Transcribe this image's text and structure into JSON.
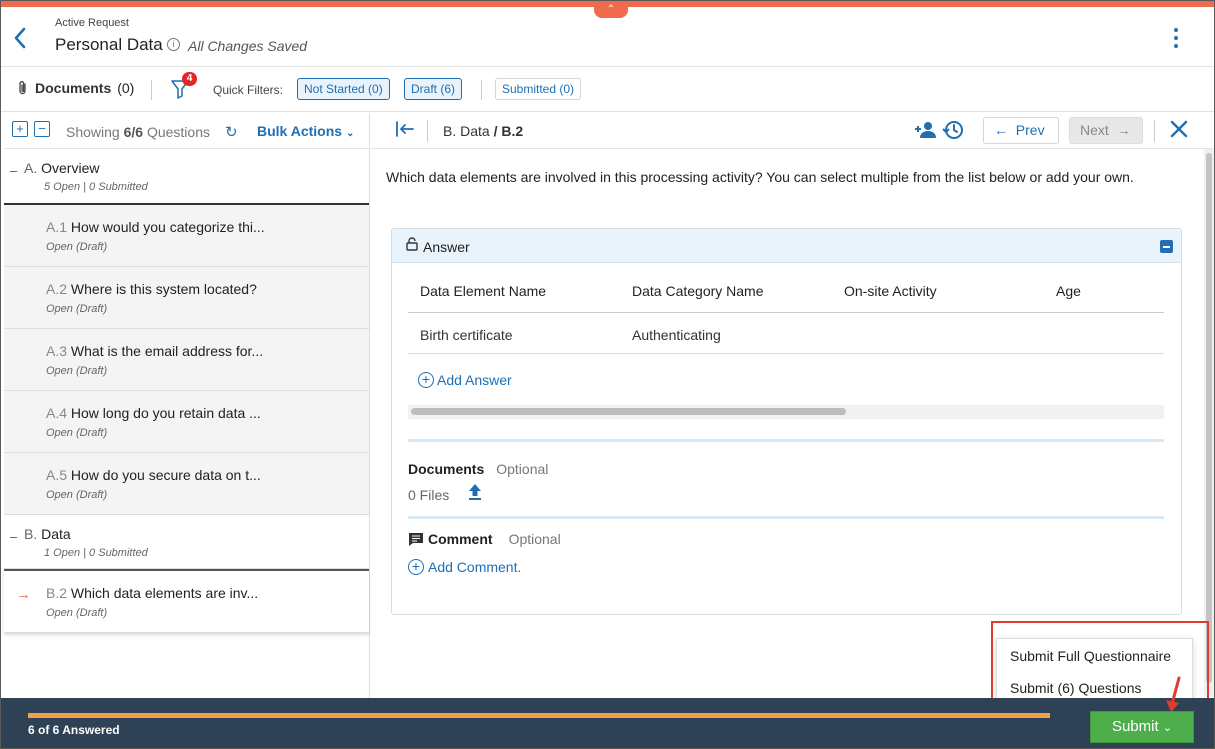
{
  "header": {
    "subtitle": "Active Request",
    "title": "Personal Data",
    "save_status": "All Changes Saved"
  },
  "toolbar": {
    "documents_label": "Documents",
    "documents_count": "(0)",
    "filter_badge": "4",
    "quick_filters_label": "Quick Filters:",
    "chips": [
      "Not Started (0)",
      "Draft (6)",
      "Submitted (0)"
    ]
  },
  "left": {
    "showing_prefix": "Showing",
    "showing_count": "6/6",
    "showing_suffix": "Questions",
    "bulk_actions": "Bulk Actions",
    "sections": [
      {
        "prefix": "A.",
        "title": "Overview",
        "meta": "5 Open | 0 Submitted",
        "questions": [
          {
            "num": "A.1",
            "title": "How would you categorize thi...",
            "meta": "Open  (Draft)"
          },
          {
            "num": "A.2",
            "title": "Where is this system located?",
            "meta": "Open  (Draft)"
          },
          {
            "num": "A.3",
            "title": "What is the email address for...",
            "meta": "Open  (Draft)"
          },
          {
            "num": "A.4",
            "title": "How long do you retain data ...",
            "meta": "Open  (Draft)"
          },
          {
            "num": "A.5",
            "title": "How do you secure data on t...",
            "meta": "Open  (Draft)"
          }
        ]
      },
      {
        "prefix": "B.",
        "title": "Data",
        "meta": "1 Open | 0 Submitted",
        "questions": [
          {
            "num": "B.2",
            "title": "Which data elements are inv...",
            "meta": "Open  (Draft)"
          }
        ]
      }
    ]
  },
  "right": {
    "crumb_section": "B. Data",
    "crumb_sep": "/",
    "crumb_question": "B.2",
    "prev_label": "Prev",
    "next_label": "Next",
    "question_text": "Which data elements are involved in this processing activity? You can select multiple from the list below or add your own.",
    "answer_title": "Answer",
    "table": {
      "headers": [
        "Data Element Name",
        "Data Category Name",
        "On-site Activity",
        "Age"
      ],
      "rows": [
        [
          "Birth certificate",
          "Authenticating",
          "",
          ""
        ]
      ]
    },
    "add_answer": "Add Answer",
    "documents_title": "Documents",
    "documents_optional": "Optional",
    "files_count": "0 Files",
    "comment_title": "Comment",
    "comment_optional": "Optional",
    "add_comment": "Add Comment."
  },
  "submit_menu": {
    "items": [
      "Submit Full Questionnaire",
      "Submit (6) Questions"
    ]
  },
  "footer": {
    "answered": "6 of 6 Answered",
    "progress_fraction": 1.0,
    "submit_label": "Submit"
  },
  "colors": {
    "accent": "#1f6fb2",
    "top_bar": "#f06b4e",
    "footer_bg": "#2f4255",
    "progress": "#f0a24b",
    "submit_green": "#4fae4c",
    "highlight_red": "#e23b2e"
  }
}
